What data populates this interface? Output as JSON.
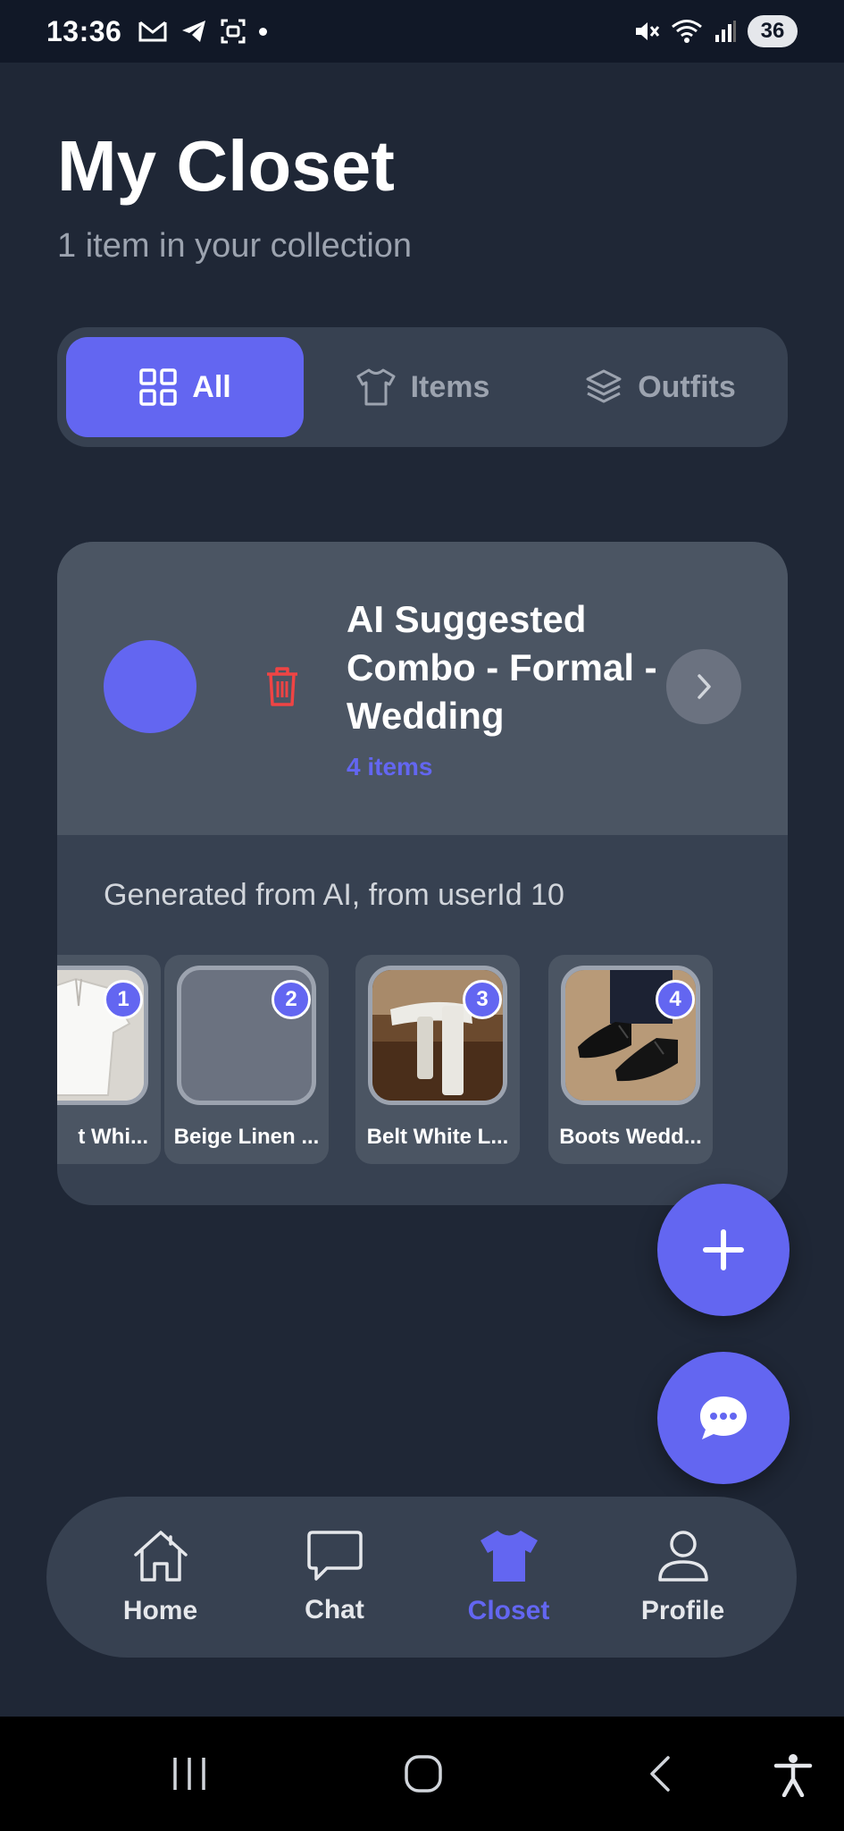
{
  "status_bar": {
    "time": "13:36",
    "battery": "36"
  },
  "header": {
    "title": "My Closet",
    "subtitle": "1 item in your collection"
  },
  "tabs": [
    {
      "label": "All",
      "icon": "grid-icon",
      "active": true
    },
    {
      "label": "Items",
      "icon": "tshirt-icon",
      "active": false
    },
    {
      "label": "Outfits",
      "icon": "layers-icon",
      "active": false
    }
  ],
  "outfit_card": {
    "title": "AI Suggested Combo - Formal - Wedding",
    "count": "4 items",
    "description": "Generated from AI, from userId 10",
    "items": [
      {
        "number": "1",
        "label": "t Whi..."
      },
      {
        "number": "2",
        "label": "Beige Linen ..."
      },
      {
        "number": "3",
        "label": "Belt White L..."
      },
      {
        "number": "4",
        "label": "Boots Wedd..."
      }
    ]
  },
  "bottom_nav": [
    {
      "label": "Home",
      "icon": "home-icon",
      "active": false
    },
    {
      "label": "Chat",
      "icon": "chat-icon",
      "active": false
    },
    {
      "label": "Closet",
      "icon": "tshirt-icon",
      "active": true
    },
    {
      "label": "Profile",
      "icon": "user-icon",
      "active": false
    }
  ],
  "colors": {
    "accent": "#6366f1",
    "background": "#1f2736",
    "card": "#374151",
    "danger": "#ef4444"
  }
}
